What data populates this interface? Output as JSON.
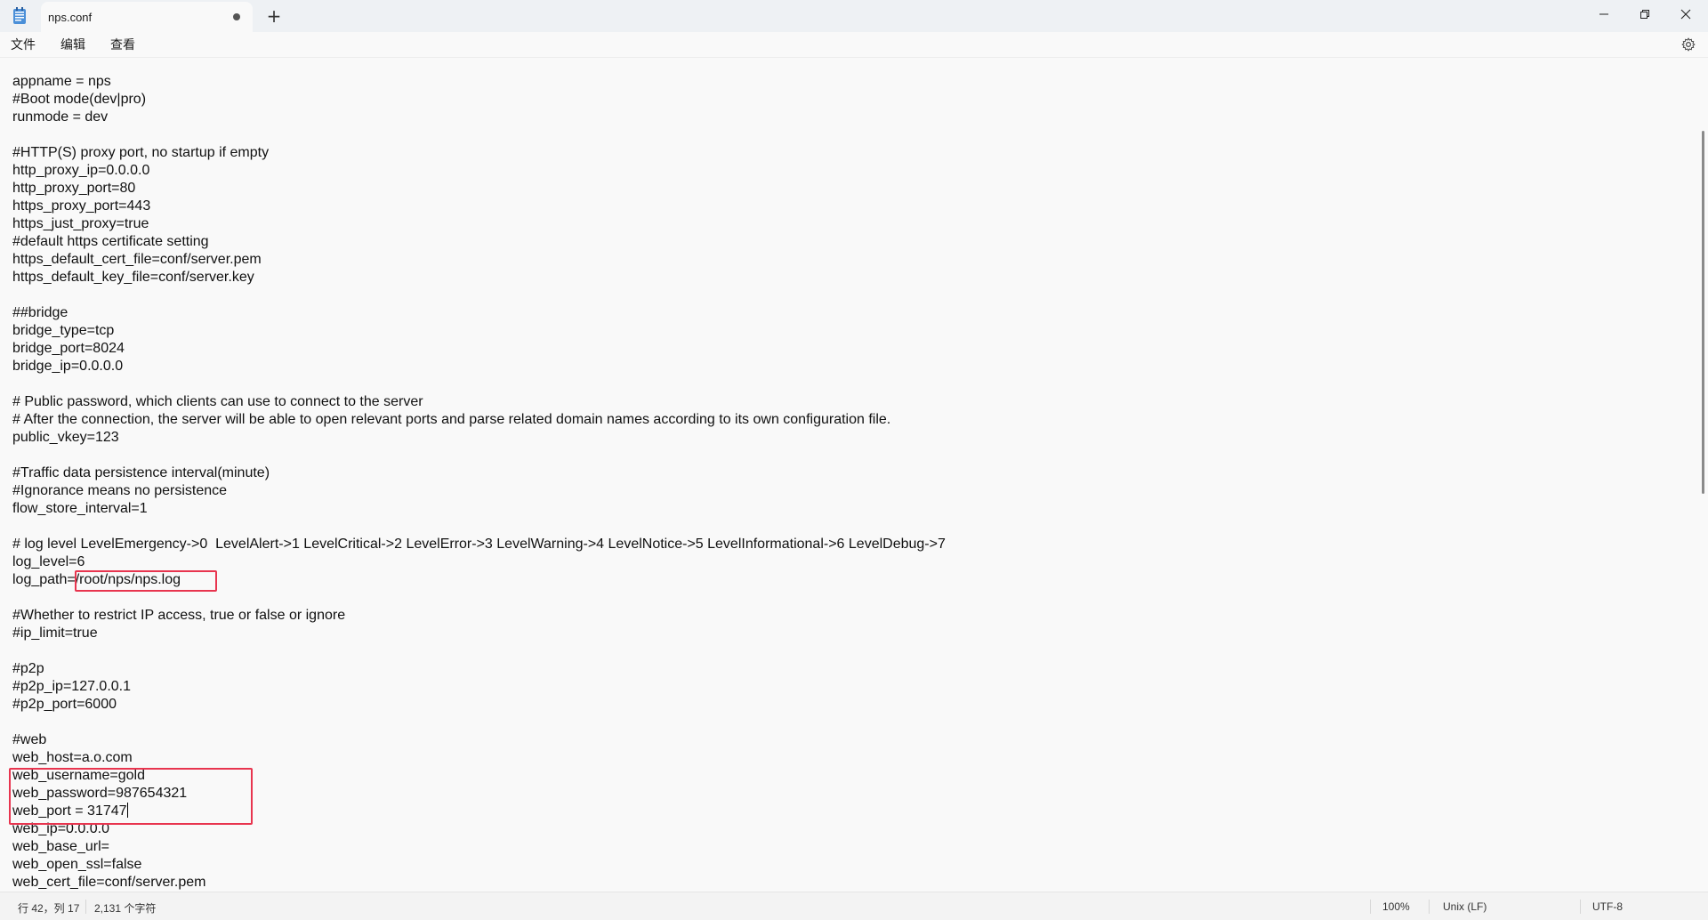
{
  "tab": {
    "title": "nps.conf"
  },
  "menu": {
    "file": "文件",
    "edit": "编辑",
    "view": "查看"
  },
  "editor": {
    "lines": [
      "appname = nps",
      "#Boot mode(dev|pro)",
      "runmode = dev",
      "",
      "#HTTP(S) proxy port, no startup if empty",
      "http_proxy_ip=0.0.0.0",
      "http_proxy_port=80",
      "https_proxy_port=443",
      "https_just_proxy=true",
      "#default https certificate setting",
      "https_default_cert_file=conf/server.pem",
      "https_default_key_file=conf/server.key",
      "",
      "##bridge",
      "bridge_type=tcp",
      "bridge_port=8024",
      "bridge_ip=0.0.0.0",
      "",
      "# Public password, which clients can use to connect to the server",
      "# After the connection, the server will be able to open relevant ports and parse related domain names according to its own configuration file.",
      "public_vkey=123",
      "",
      "#Traffic data persistence interval(minute)",
      "#Ignorance means no persistence",
      "flow_store_interval=1",
      "",
      "# log level LevelEmergency->0  LevelAlert->1 LevelCritical->2 LevelError->3 LevelWarning->4 LevelNotice->5 LevelInformational->6 LevelDebug->7",
      "log_level=6",
      "log_path=/root/nps/nps.log",
      "",
      "#Whether to restrict IP access, true or false or ignore",
      "#ip_limit=true",
      "",
      "#p2p",
      "#p2p_ip=127.0.0.1",
      "#p2p_port=6000",
      "",
      "#web",
      "web_host=a.o.com",
      "web_username=gold",
      "web_password=987654321",
      "web_port = 31747",
      "web_ip=0.0.0.0",
      "web_base_url=",
      "web_open_ssl=false",
      "web_cert_file=conf/server.pem"
    ]
  },
  "status": {
    "position": "行 42，列 17",
    "chars": "2,131 个字符",
    "zoom": "100%",
    "line_ending": "Unix (LF)",
    "encoding": "UTF-8"
  },
  "colors": {
    "highlight": "#e8354f",
    "titlebar": "#eef1f4",
    "editor_bg": "#f9f9f9"
  }
}
